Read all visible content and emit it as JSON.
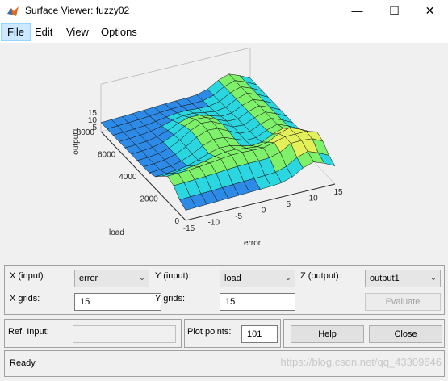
{
  "window": {
    "title": "Surface Viewer: fuzzy02",
    "minimize_glyph": "—",
    "maximize_glyph": "☐",
    "close_glyph": "✕"
  },
  "menu": [
    "File",
    "Edit",
    "View",
    "Options"
  ],
  "plot": {
    "zlabel": "output1",
    "xlabel": "error",
    "ylabel": "load",
    "z_ticks": [
      "15",
      "10",
      "5"
    ],
    "y_ticks": [
      "8000",
      "6000",
      "4000",
      "2000",
      "0"
    ],
    "x_ticks": [
      "-15",
      "-10",
      "-5",
      "0",
      "5",
      "10",
      "15"
    ],
    "colormap": [
      "#1f3fcf",
      "#2d8ae6",
      "#2ad6e0",
      "#7ef06a",
      "#e4f05a"
    ]
  },
  "controls": {
    "x_input_label": "X (input):",
    "x_input_value": "error",
    "y_input_label": "Y (input):",
    "y_input_value": "load",
    "z_output_label": "Z (output):",
    "z_output_value": "output1",
    "x_grids_label": "X grids:",
    "x_grids_value": "15",
    "y_grids_label": "Y grids:",
    "y_grids_value": "15",
    "evaluate_label": "Evaluate",
    "ref_input_label": "Ref. Input:",
    "ref_input_value": "",
    "plot_points_label": "Plot points:",
    "plot_points_value": "101",
    "help_label": "Help",
    "close_label": "Close"
  },
  "status": {
    "text": "Ready",
    "watermark": "https://blog.csdn.net/qq_43309646"
  }
}
